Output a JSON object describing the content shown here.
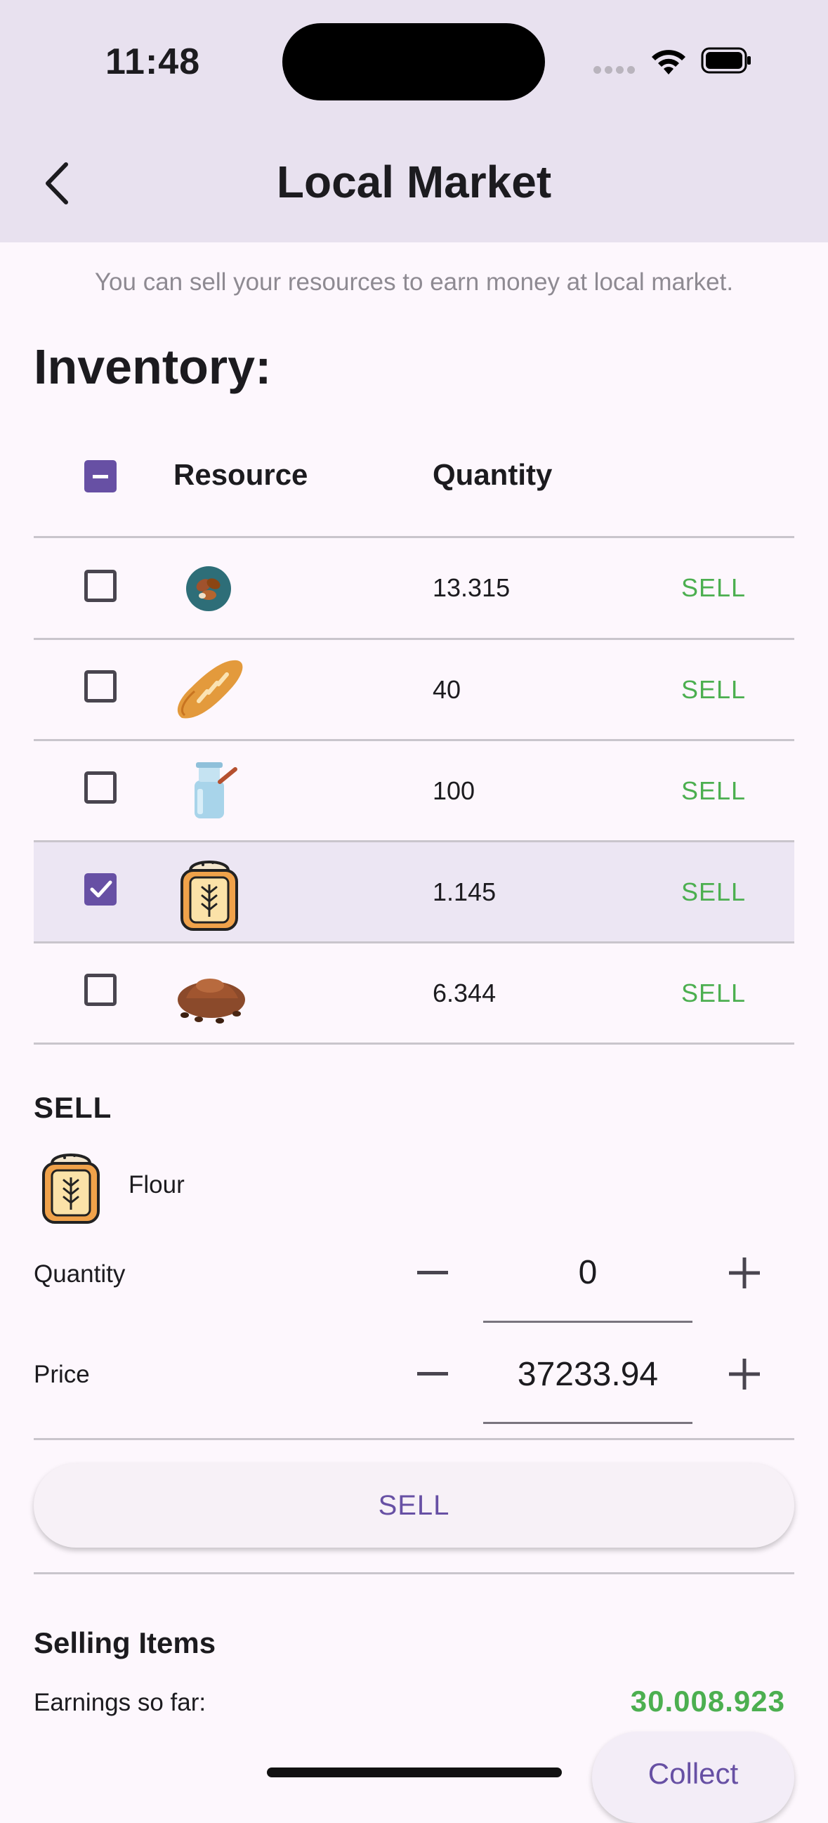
{
  "status_bar": {
    "time": "11:48"
  },
  "app_bar": {
    "title": "Local Market"
  },
  "subtitle": "You can sell your resources to earn money at local market.",
  "inventory": {
    "title": "Inventory:",
    "columns": [
      "Resource",
      "Quantity"
    ],
    "sell_label": "SELL",
    "rows": [
      {
        "icon": "cocoa-beans-icon",
        "quantity": "13.315",
        "checked": false
      },
      {
        "icon": "bread-icon",
        "quantity": "40",
        "checked": false
      },
      {
        "icon": "milk-can-icon",
        "quantity": "100",
        "checked": false
      },
      {
        "icon": "flour-sack-icon",
        "quantity": "1.145",
        "checked": true
      },
      {
        "icon": "cocoa-powder-icon",
        "quantity": "6.344",
        "checked": false
      }
    ]
  },
  "sell_panel": {
    "title": "SELL",
    "item_name": "Flour",
    "item_icon": "flour-sack-icon",
    "quantity_label": "Quantity",
    "quantity_value": "0",
    "price_label": "Price",
    "price_value": "37233.94",
    "button_label": "SELL"
  },
  "selling_items": {
    "title": "Selling Items",
    "earnings_label": "Earnings so far:",
    "earnings_value": "30.008.923",
    "collect_label": "Collect"
  },
  "colors": {
    "accent": "#6750a4",
    "sell_green": "#4caf50",
    "app_bar_bg": "#e8e1ef",
    "page_bg": "#fdf7fd"
  }
}
